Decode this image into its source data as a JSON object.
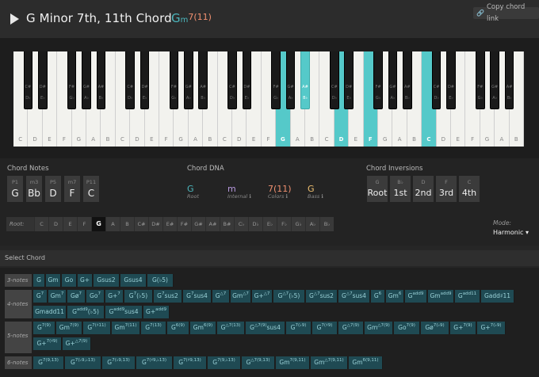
{
  "header": {
    "title": "G Minor 7th, 11th Chord",
    "symbol_root": "G",
    "symbol_quality": "m",
    "symbol_ext": "7(11)",
    "copy_link": "Copy chord link"
  },
  "keyboard": {
    "white_keys": [
      "C",
      "D",
      "E",
      "F",
      "G",
      "A",
      "B",
      "C",
      "D",
      "E",
      "F",
      "G",
      "A",
      "B",
      "C",
      "D",
      "E",
      "F",
      "G",
      "A",
      "B",
      "C",
      "D",
      "E",
      "F",
      "G",
      "A",
      "B",
      "C",
      "D",
      "E",
      "F",
      "G",
      "A",
      "B"
    ],
    "white_highlight": [
      18,
      22,
      24,
      28
    ],
    "black_keys": [
      {
        "a": "C#",
        "b": "D♭"
      },
      {
        "a": "D#",
        "b": "E♭"
      },
      {
        "a": "F#",
        "b": "G♭"
      },
      {
        "a": "G#",
        "b": "A♭"
      },
      {
        "a": "A#",
        "b": "B♭"
      },
      {
        "a": "C#",
        "b": "D♭"
      },
      {
        "a": "D#",
        "b": "E♭"
      },
      {
        "a": "F#",
        "b": "G♭"
      },
      {
        "a": "G#",
        "b": "A♭"
      },
      {
        "a": "A#",
        "b": "B♭"
      },
      {
        "a": "C#",
        "b": "D♭"
      },
      {
        "a": "D#",
        "b": "E♭"
      },
      {
        "a": "F#",
        "b": "G♭"
      },
      {
        "a": "G#",
        "b": "A♭"
      },
      {
        "a": "A#",
        "b": "B♭"
      },
      {
        "a": "C#",
        "b": "D♭"
      },
      {
        "a": "D#",
        "b": "E♭"
      },
      {
        "a": "F#",
        "b": "G♭"
      },
      {
        "a": "G#",
        "b": "A♭"
      },
      {
        "a": "A#",
        "b": "B♭"
      },
      {
        "a": "C#",
        "b": "D♭"
      },
      {
        "a": "D#",
        "b": "E♭"
      },
      {
        "a": "F#",
        "b": "G♭"
      },
      {
        "a": "G#",
        "b": "A♭"
      },
      {
        "a": "A#",
        "b": "B♭"
      }
    ],
    "black_highlight": [
      14
    ]
  },
  "chord_notes": {
    "title": "Chord Notes",
    "items": [
      {
        "interval": "P1",
        "note": "G"
      },
      {
        "interval": "m3",
        "note": "Bb"
      },
      {
        "interval": "P5",
        "note": "D"
      },
      {
        "interval": "m7",
        "note": "F"
      },
      {
        "interval": "P11",
        "note": "C"
      }
    ]
  },
  "chord_dna": {
    "title": "Chord DNA",
    "root": "G",
    "root_label": "Root",
    "internal": "m",
    "internal_label": "Internal ℹ",
    "colors": "7(11)",
    "colors_label": "Colors ℹ",
    "bass": "G",
    "bass_label": "Bass ℹ"
  },
  "inversions": {
    "title": "Chord Inversions",
    "items": [
      {
        "note": "G",
        "label": "Root"
      },
      {
        "note": "B♭",
        "label": "1st"
      },
      {
        "note": "D",
        "label": "2nd"
      },
      {
        "note": "F",
        "label": "3rd"
      },
      {
        "note": "C",
        "label": "4th"
      }
    ]
  },
  "root_selector": {
    "label": "Root:",
    "roots": [
      "C",
      "D",
      "E",
      "F",
      "G",
      "A",
      "B",
      "C#",
      "D#",
      "E#",
      "F#",
      "G#",
      "A#",
      "B#",
      "C♭",
      "D♭",
      "E♭",
      "F♭",
      "G♭",
      "A♭",
      "B♭"
    ],
    "selected": 4
  },
  "mode": {
    "label": "Mode:",
    "value": "Harmonic ▾"
  },
  "select_chord": {
    "title": "Select Chord",
    "rows": [
      {
        "label": "3-notes",
        "chips": [
          {
            "t": "G"
          },
          {
            "t": "Gm"
          },
          {
            "t": "Go"
          },
          {
            "t": "G+"
          },
          {
            "t": "Gsus2"
          },
          {
            "t": "Gsus4"
          },
          {
            "t": "G(♭5)"
          }
        ]
      },
      {
        "label": "4-notes",
        "chips": [
          {
            "t": "G",
            "s": "7"
          },
          {
            "t": "Gm",
            "s": "7"
          },
          {
            "t": "Gø",
            "s": "7"
          },
          {
            "t": "Go",
            "s": "7"
          },
          {
            "t": "G+",
            "s": "7"
          },
          {
            "t": "G",
            "s": "7",
            "e": "(♭5)"
          },
          {
            "t": "G",
            "s": "7",
            "e": "sus2"
          },
          {
            "t": "G",
            "s": "7",
            "e": "sus4"
          },
          {
            "t": "G",
            "s": "△7"
          },
          {
            "t": "Gm",
            "s": "△7"
          },
          {
            "t": "G+",
            "s": "△7"
          },
          {
            "t": "G",
            "s": "△7",
            "e": "(♭5)"
          },
          {
            "t": "G",
            "s": "△7",
            "e": "sus2"
          },
          {
            "t": "G",
            "s": "△7",
            "e": "sus4"
          },
          {
            "t": "G",
            "s": "6"
          },
          {
            "t": "Gm",
            "s": "6"
          },
          {
            "t": "G",
            "s": "add9"
          },
          {
            "t": "Gm",
            "s": "add9"
          },
          {
            "t": "G",
            "s": "add11"
          },
          {
            "t": "G",
            "e": "add♯11"
          },
          {
            "t": "Gm",
            "e": "add11"
          },
          {
            "t": "G",
            "s": "add9",
            "e": "(♭5)"
          },
          {
            "t": "G",
            "s": "add9",
            "e": "sus4"
          },
          {
            "t": "G+",
            "s": "add9"
          }
        ]
      },
      {
        "label": "5-notes",
        "chips": [
          {
            "t": "G",
            "s": "7(9)"
          },
          {
            "t": "Gm",
            "s": "7(9)"
          },
          {
            "t": "G",
            "s": "7(♯11)"
          },
          {
            "t": "Gm",
            "s": "7(11)"
          },
          {
            "t": "G",
            "s": "7(13)"
          },
          {
            "t": "G",
            "s": "6(9)"
          },
          {
            "t": "Gm",
            "s": "6(9)"
          },
          {
            "t": "G",
            "s": "△7(13)"
          },
          {
            "t": "G",
            "s": "△7(9)",
            "e": "sus4"
          },
          {
            "t": "G",
            "s": "7(♭9)"
          },
          {
            "t": "G",
            "s": "7(♯9)"
          },
          {
            "t": "G",
            "s": "△7(9)"
          },
          {
            "t": "Gm",
            "s": "△7(9)"
          },
          {
            "t": "Go",
            "s": "7(9)"
          },
          {
            "t": "Gø",
            "s": "7(♭9)"
          },
          {
            "t": "G+",
            "s": "7(9)"
          },
          {
            "t": "G+",
            "s": "7(♭9)"
          },
          {
            "t": "G+",
            "s": "7(♯9)"
          },
          {
            "t": "G+",
            "s": "△7(9)"
          }
        ]
      },
      {
        "label": "6-notes",
        "chips": [
          {
            "t": "G",
            "s": "7(9,13)"
          },
          {
            "t": "G",
            "s": "7(♭9,♭13)"
          },
          {
            "t": "G",
            "s": "7(♭9,13)"
          },
          {
            "t": "G",
            "s": "7(♯9,♭13)"
          },
          {
            "t": "G",
            "s": "7(♯9,13)"
          },
          {
            "t": "G",
            "s": "7(9,♭13)"
          },
          {
            "t": "G",
            "s": "△7(9,13)"
          },
          {
            "t": "Gm",
            "s": "7(9,11)"
          },
          {
            "t": "Gm",
            "s": "△7(9,11)"
          },
          {
            "t": "Gm",
            "s": "6(9,11)"
          }
        ]
      }
    ]
  }
}
